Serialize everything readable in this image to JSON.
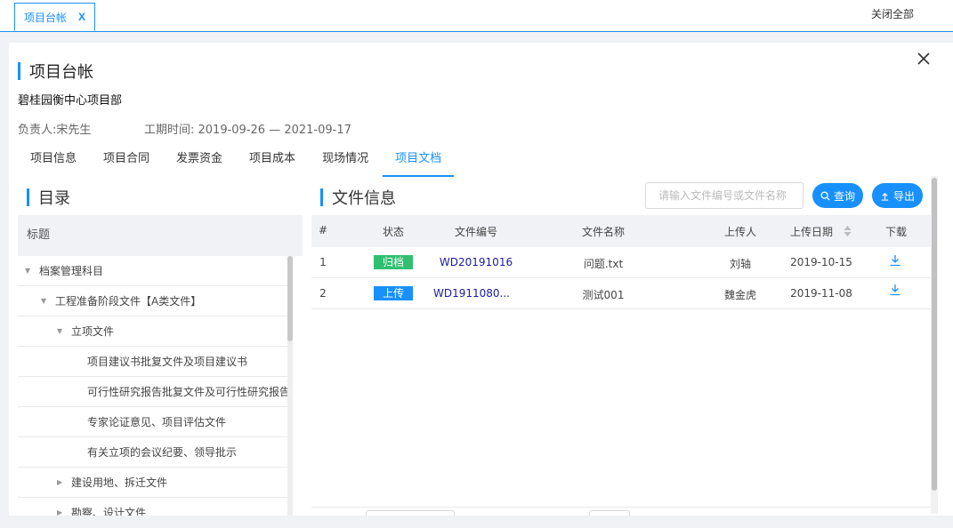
{
  "tabbar": {
    "tab_label": "项目台帐",
    "tab_close": "X",
    "close_all": "关闭全部"
  },
  "panel": {
    "title": "项目台帐",
    "project_name": "碧桂园衡中心项目部",
    "manager": "负责人:宋先生",
    "period": "工期时间: 2019-09-26 — 2021-09-17"
  },
  "subtabs": [
    "项目信息",
    "项目合同",
    "发票资金",
    "项目成本",
    "现场情况",
    "项目文档"
  ],
  "active_subtab": "项目文档",
  "directory": {
    "title": "目录",
    "header": "标题",
    "items": [
      {
        "label": "档案管理科目",
        "caret": "down"
      },
      {
        "label": "工程准备阶段文件【A类文件】",
        "caret": "down"
      },
      {
        "label": "立项文件",
        "caret": "down"
      },
      {
        "label": "项目建议书批复文件及项目建议书",
        "caret": ""
      },
      {
        "label": "可行性研究报告批复文件及可行性研究报告",
        "caret": ""
      },
      {
        "label": "专家论证意见、项目评估文件",
        "caret": ""
      },
      {
        "label": "有关立项的会议纪要、领导批示",
        "caret": ""
      },
      {
        "label": "建设用地、拆迁文件",
        "caret": "right"
      },
      {
        "label": "勘察、设计文件",
        "caret": "right"
      }
    ]
  },
  "files": {
    "title": "文件信息",
    "search_placeholder": "请输入文件编号或文件名称",
    "query_button": "查询",
    "export_button": "导出",
    "columns": [
      "#",
      "状态",
      "文件编号",
      "文件名称",
      "上传人",
      "上传日期",
      "下载"
    ],
    "rows": [
      {
        "index": "1",
        "status": "归档",
        "status_color": "#2fbf71",
        "code": "WD20191016",
        "name": "问题.txt",
        "uploader": "刘轴",
        "date": "2019-10-15"
      },
      {
        "index": "2",
        "status": "上传",
        "status_color": "#1890ff",
        "code": "WD1911080...",
        "name": "测试001",
        "uploader": "魏金虎",
        "date": "2019-11-08"
      }
    ]
  },
  "colors": {
    "accent": "#1890ff",
    "header_bg": "#f0f2f5"
  }
}
